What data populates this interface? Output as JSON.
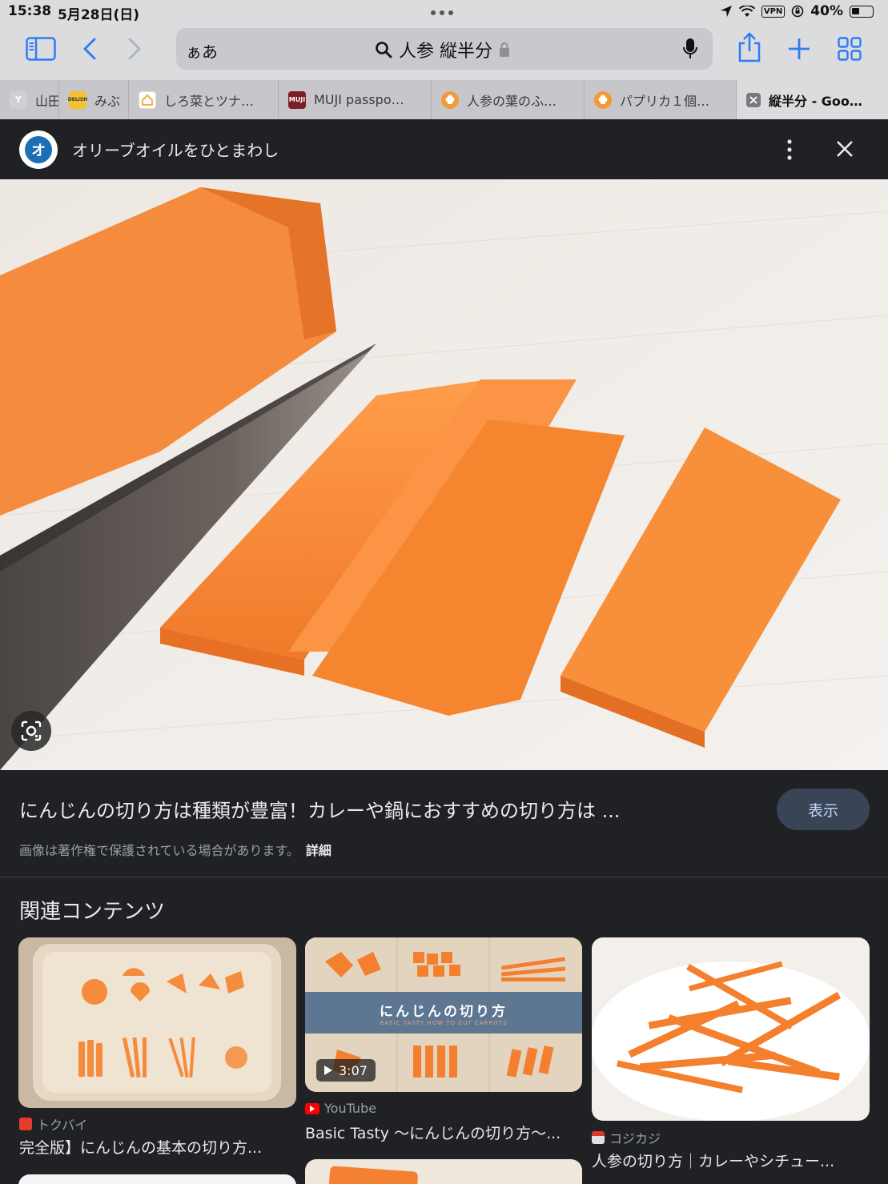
{
  "status_bar": {
    "time": "15:38",
    "date": "5月28日(日)",
    "vpn": "VPN",
    "battery": "40%",
    "battery_level": 0.4
  },
  "address_bar": {
    "reader_label": "ぁあ",
    "query": "人参 縦半分"
  },
  "tabs": [
    {
      "label": "山田",
      "favicon": "Y",
      "color": "#c7c7cb"
    },
    {
      "label": "みぶ",
      "favicon": "DELISH",
      "color": "#f2c230"
    },
    {
      "label": "しろ菜とツナ…",
      "favicon": "house",
      "color": "#ffffff"
    },
    {
      "label": "MUJI passpo…",
      "favicon": "MUJI",
      "color": "#7a1f24"
    },
    {
      "label": "人参の葉のふ…",
      "favicon": "chef",
      "color": "#f39a36"
    },
    {
      "label": "パプリカ１個…",
      "favicon": "chef",
      "color": "#f39a36"
    },
    {
      "label": "縦半分 - Goo…",
      "favicon": "close",
      "color": "#4a4a4c"
    }
  ],
  "sheet_header": {
    "logo_glyph": "オ",
    "title": "オリーブオイルをひとまわし"
  },
  "result": {
    "title": "にんじんの切り方は種類が豊富！カレーや鍋におすすめの切り方は ...",
    "show_button": "表示",
    "copyright": "画像は著作権で保護されている場合があります。",
    "details": "詳細"
  },
  "related": {
    "heading": "関連コンテンツ",
    "cards": [
      {
        "source": "トクバイ",
        "title": "完全版】にんじんの基本の切り方..."
      },
      {
        "source": "YouTube",
        "title": "Basic Tasty 〜にんじんの切り方〜...",
        "duration": "3:07",
        "banner_title": "にんじんの切り方",
        "banner_sub": "BASIC TASTY HOW TO CUT CARROTS"
      },
      {
        "source": "コジカジ",
        "title": "人参の切り方｜カレーやシチュー..."
      }
    ]
  }
}
